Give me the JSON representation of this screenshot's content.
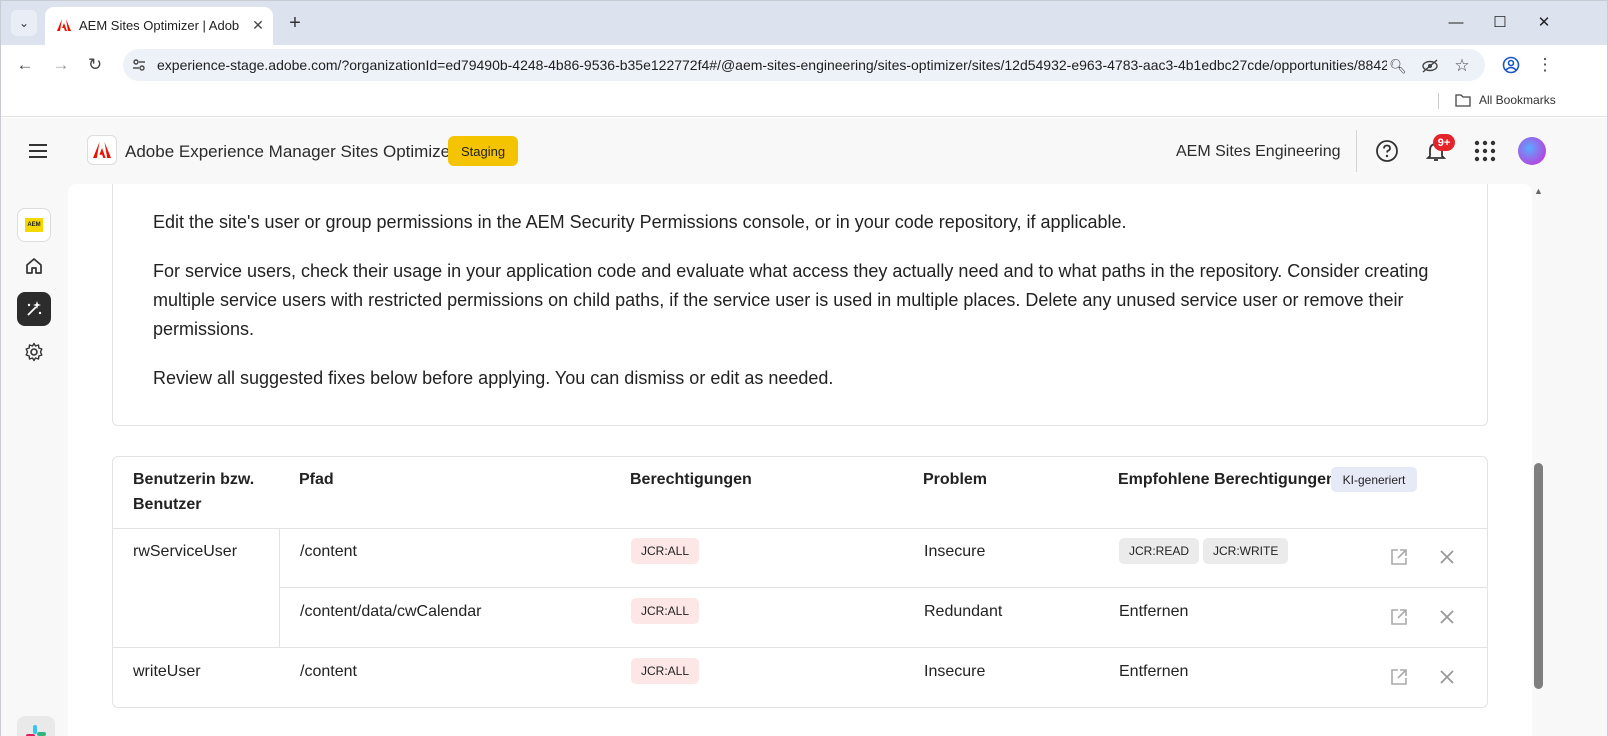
{
  "browser": {
    "tab_title": "AEM Sites Optimizer | Adobe Ex",
    "url": "experience-stage.adobe.com/?organizationId=ed79490b-4248-4b86-9536-b35e122772f4#/@aem-sites-engineering/sites-optimizer/sites/12d54932-e963-4783-aac3-4b1edbc27cde/opportunities/8842...",
    "bookmarks_label": "All Bookmarks"
  },
  "header": {
    "app_title": "Adobe Experience Manager Sites Optimizer",
    "env_badge": "Staging",
    "org_name": "AEM Sites Engineering",
    "notification_count": "9+"
  },
  "description": {
    "p1": "Edit the site's user or group permissions in the AEM Security Permissions console, or in your code repository, if applicable.",
    "p2": "For service users, check their usage in your application code and evaluate what access they actually need and to what paths in the repository. Consider creating multiple service users with restricted permissions on child paths, if the service user is used in multiple places. Delete any unused service user or remove their permissions.",
    "p3": "Review all suggested fixes below before applying. You can dismiss or edit as needed."
  },
  "table": {
    "headers": {
      "user": "Benutzerin bzw. Benutzer",
      "path": "Pfad",
      "permissions": "Berechtigungen",
      "problem": "Problem",
      "recommended": "Empfohlene Berechtigungen"
    },
    "ai_badge": "KI-generiert",
    "rows": [
      {
        "user": "rwServiceUser",
        "path": "/content",
        "permission": "JCR:ALL",
        "problem": "Insecure",
        "rec_chips": [
          "JCR:READ",
          "JCR:WRITE"
        ],
        "rec_text": ""
      },
      {
        "user": "",
        "path": "/content/data/cwCalendar",
        "permission": "JCR:ALL",
        "problem": "Redundant",
        "rec_chips": [],
        "rec_text": "Entfernen"
      },
      {
        "user": "writeUser",
        "path": "/content",
        "permission": "JCR:ALL",
        "problem": "Insecure",
        "rec_chips": [],
        "rec_text": "Entfernen"
      }
    ]
  },
  "colors": {
    "staging": "#f5c400",
    "adobe_red": "#eb1000",
    "chip_red_bg": "#fde7e6",
    "chip_gray_bg": "#ebebeb",
    "ai_badge_bg": "#e6eaf7"
  }
}
